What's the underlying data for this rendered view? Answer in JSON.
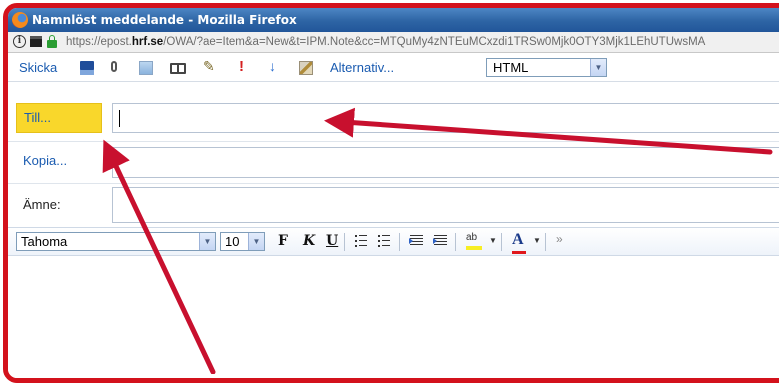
{
  "window": {
    "title": "Namnlöst meddelande - Mozilla Firefox"
  },
  "urlbar": {
    "url_prefix": "https://epost.",
    "url_domain": "hrf.se",
    "url_suffix": "/OWA/?ae=Item&a=New&t=IPM.Note&cc=MTQuMy4zNTEuMCxzdi1TRSw0Mjk0OTY3Mjk1LEhUTUwsMA"
  },
  "toolbar": {
    "send_label": "Skicka",
    "options_label": "Alternativ...",
    "format_value": "HTML"
  },
  "compose": {
    "to_label": "Till...",
    "cc_label": "Kopia...",
    "subject_label": "Ämne:"
  },
  "format_toolbar": {
    "font_value": "Tahoma",
    "size_value": "10",
    "bold_glyph": "F",
    "italic_glyph": "K",
    "underline_glyph": "U",
    "highlight_glyph": "ab",
    "font_color_glyph": "A"
  },
  "colors": {
    "frame_red": "#d3121c",
    "arrow_red": "#c8102e",
    "to_button_yellow": "#f9d72b",
    "link_blue": "#1a5bb0",
    "titlebar_blue": "#2d64a4"
  }
}
